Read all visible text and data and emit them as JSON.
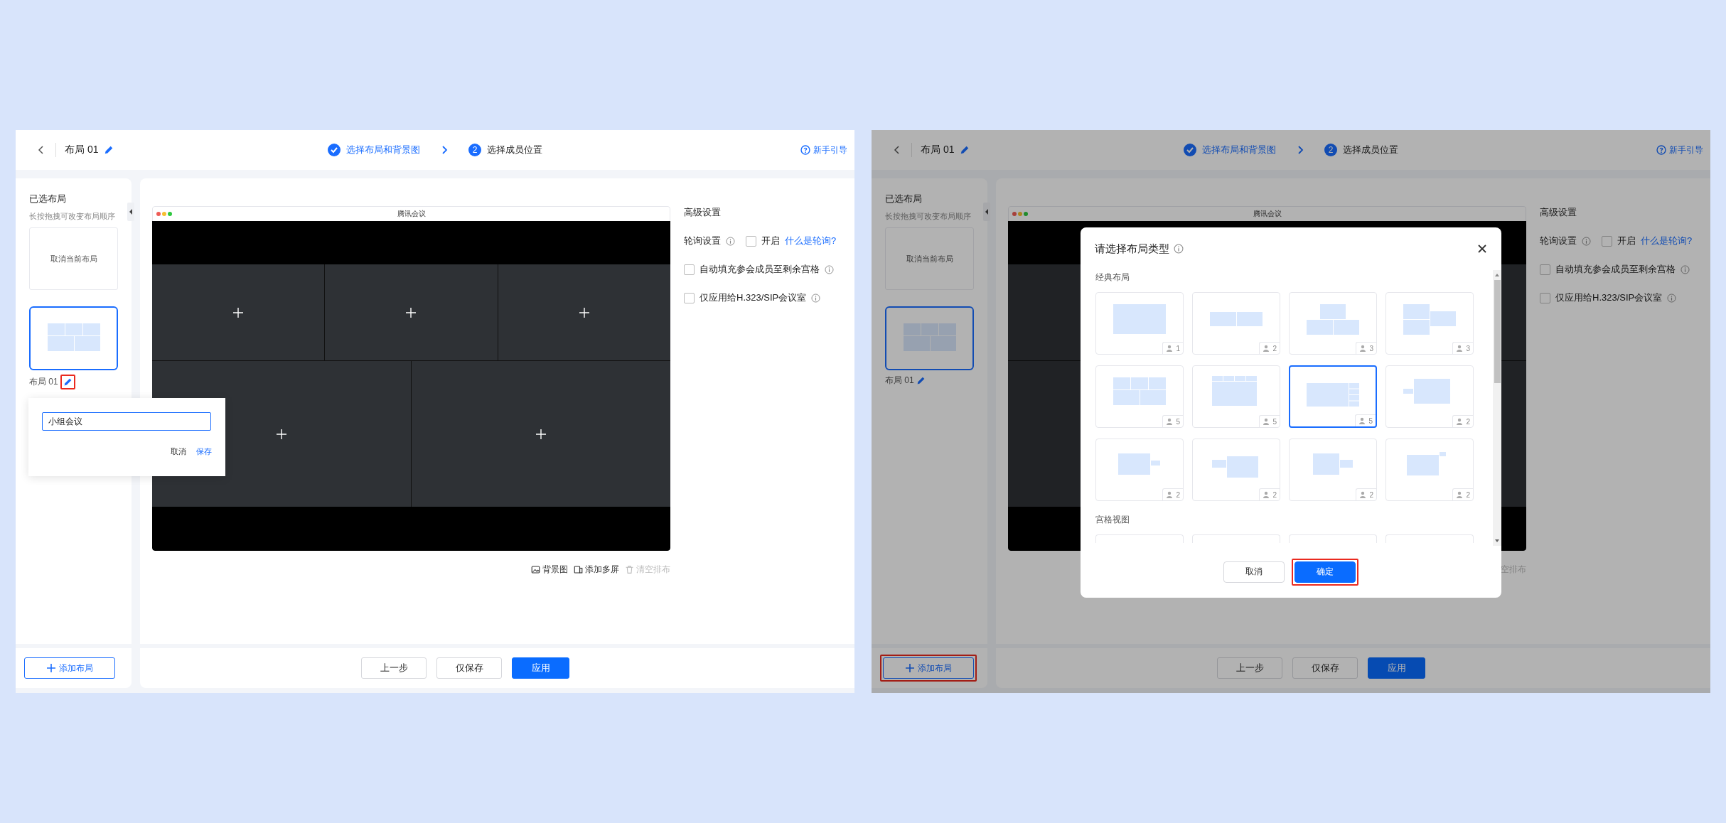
{
  "screens": [
    {
      "dimmed": false,
      "header": {
        "title": "布局 01",
        "steps": [
          {
            "label": "选择布局和背景图",
            "done": true
          },
          {
            "number": "2",
            "label": "选择成员位置",
            "done": false
          }
        ],
        "help": "新手引导"
      },
      "sidebar": {
        "title": "已选布局",
        "hint": "长按拖拽可改变布局顺序",
        "cancel_card": "取消当前布局",
        "layouts": [
          {
            "name": "布局 01",
            "kind": "grid-3-2",
            "selected": true,
            "edit_highlighted": true
          }
        ],
        "add_button": {
          "label": "添加布局",
          "highlighted": false
        }
      },
      "canvas": {
        "title": "腾讯会议",
        "rows": [
          [
            {
              "add": true
            },
            {
              "add": true
            },
            {
              "add": true
            }
          ],
          [
            {
              "add": true
            },
            {
              "add": true
            }
          ]
        ]
      },
      "toolbar": [
        {
          "kind": "background",
          "label": "背景图",
          "disabled": false
        },
        {
          "kind": "screens",
          "label": "添加多屏",
          "disabled": false
        },
        {
          "kind": "clear",
          "label": "清空排布",
          "disabled": true
        }
      ],
      "settings": {
        "title": "高级设置",
        "rows": [
          {
            "kind": "poll",
            "label": "轮询设置",
            "info": true,
            "option": "开启",
            "checked": false,
            "link": "什么是轮询?"
          },
          {
            "kind": "check",
            "label": "自动填充参会成员至剩余宫格",
            "info": true,
            "checked": false
          },
          {
            "kind": "check",
            "label": "仅应用给H.323/SIP会议室",
            "info": true,
            "checked": false
          }
        ]
      },
      "footer": [
        {
          "label": "上一步",
          "primary": false
        },
        {
          "label": "仅保存",
          "primary": false
        },
        {
          "label": "应用",
          "primary": true
        }
      ],
      "rename_popup": {
        "value": "小组会议",
        "cancel": "取消",
        "save": "保存"
      }
    },
    {
      "dimmed": true,
      "header": {
        "title": "布局 01",
        "steps": [
          {
            "label": "选择布局和背景图",
            "done": true
          },
          {
            "number": "2",
            "label": "选择成员位置",
            "done": false
          }
        ],
        "help": "新手引导"
      },
      "sidebar": {
        "title": "已选布局",
        "hint": "长按拖拽可改变布局顺序",
        "cancel_card": "取消当前布局",
        "layouts": [
          {
            "name": "布局 01",
            "kind": "grid-3-2",
            "selected": true,
            "edit_highlighted": false
          }
        ],
        "add_button": {
          "label": "添加布局",
          "highlighted": true
        }
      },
      "canvas": {
        "title": "腾讯会议",
        "rows": [
          [
            {},
            {}
          ],
          [
            {},
            {}
          ]
        ]
      },
      "toolbar": [
        {
          "kind": "text",
          "label": "空排布",
          "disabled": true
        }
      ],
      "settings": {
        "title": "高级设置",
        "rows": [
          {
            "kind": "poll",
            "label": "轮询设置",
            "info": true,
            "option": "开启",
            "checked": false,
            "link": "什么是轮询?"
          },
          {
            "kind": "check",
            "label": "自动填充参会成员至剩余宫格",
            "info": true,
            "checked": false
          },
          {
            "kind": "check",
            "label": "仅应用给H.323/SIP会议室",
            "info": true,
            "checked": false
          }
        ]
      },
      "footer": [
        {
          "label": "上一步",
          "primary": false
        },
        {
          "label": "仅保存",
          "primary": false
        },
        {
          "label": "应用",
          "primary": true
        }
      ],
      "modal": {
        "title": "请选择布局类型",
        "info": true,
        "sections": [
          {
            "label": "经典布局",
            "cards": [
              {
                "kind": "single",
                "count": "1",
                "selected": false
              },
              {
                "kind": "duo",
                "count": "2",
                "selected": false
              },
              {
                "kind": "pyramid",
                "count": "3",
                "selected": false
              },
              {
                "kind": "stack-right",
                "count": "3",
                "selected": false
              },
              {
                "kind": "grid-3-2",
                "count": "5",
                "selected": false
              },
              {
                "kind": "top-strip",
                "count": "5",
                "selected": false
              },
              {
                "kind": "main-side",
                "count": "5",
                "selected": true
              },
              {
                "kind": "pip-left",
                "count": "2",
                "selected": false
              },
              {
                "kind": "big-small-right",
                "count": "2",
                "selected": false
              },
              {
                "kind": "small-left-big",
                "count": "2",
                "selected": false
              },
              {
                "kind": "big-small-mid",
                "count": "2",
                "selected": false
              },
              {
                "kind": "big-corner",
                "count": "2",
                "selected": false
              }
            ]
          },
          {
            "label": "宫格视图",
            "cards": [
              {
                "kind": "blank",
                "selected": false
              },
              {
                "kind": "blank",
                "selected": false
              },
              {
                "kind": "blank",
                "selected": false
              },
              {
                "kind": "blank",
                "selected": false
              }
            ]
          }
        ],
        "cancel": "取消",
        "confirm": {
          "label": "确定",
          "highlighted": true
        }
      }
    }
  ]
}
